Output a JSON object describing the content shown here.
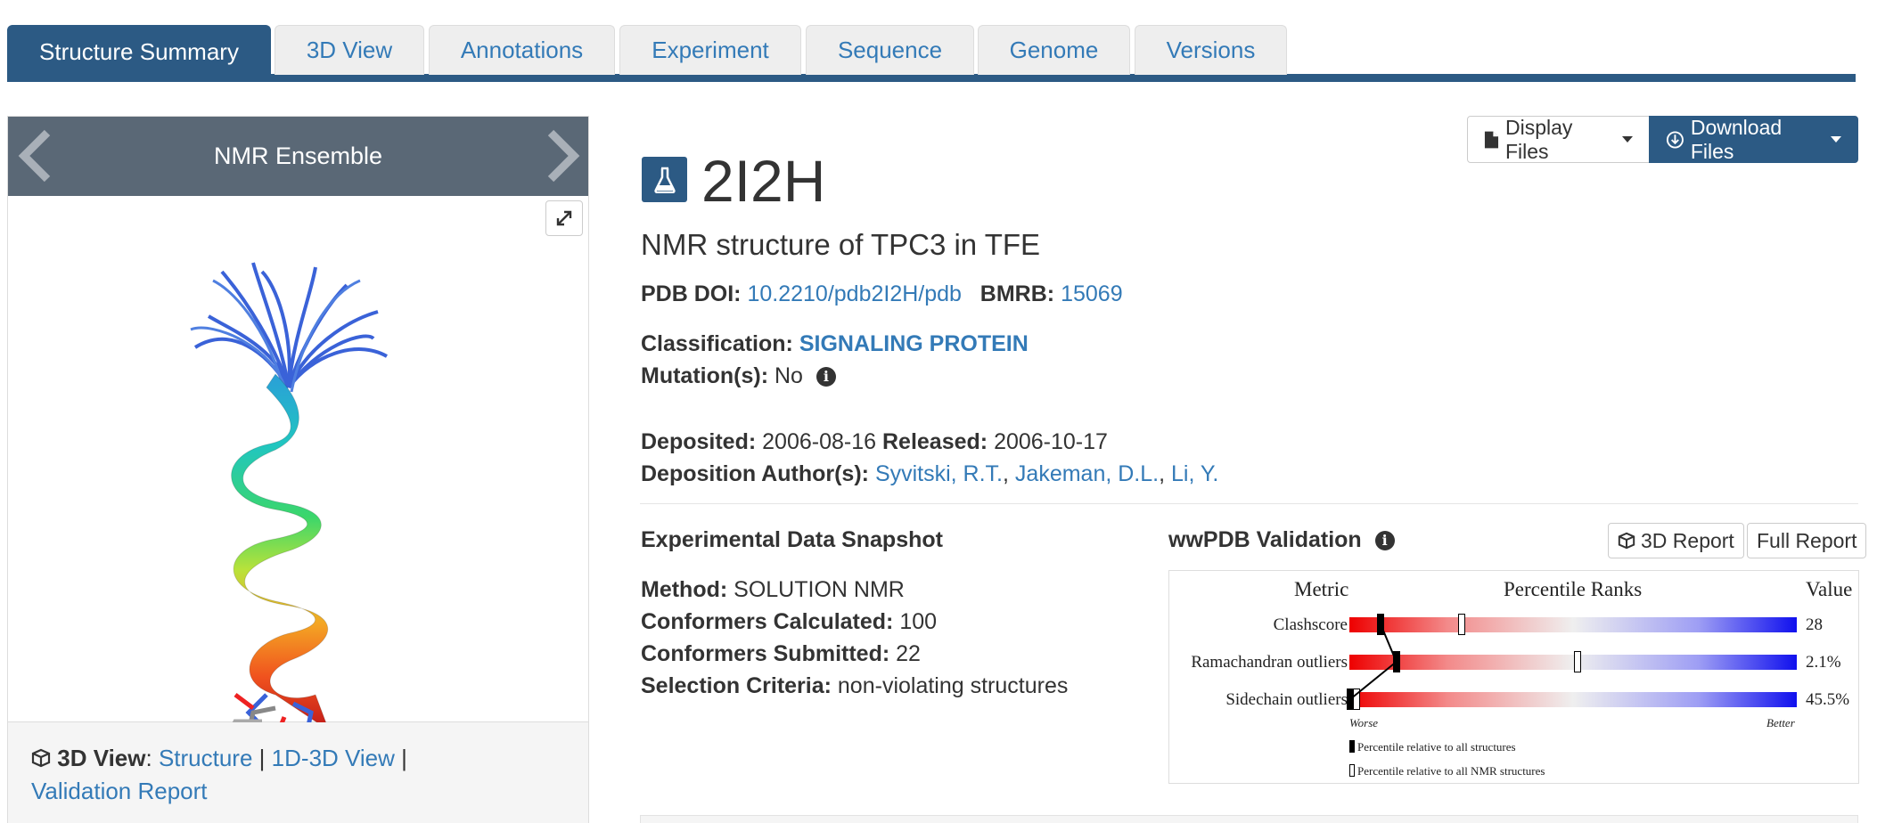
{
  "tabs": [
    "Structure Summary",
    "3D View",
    "Annotations",
    "Experiment",
    "Sequence",
    "Genome",
    "Versions"
  ],
  "active_tab": "Structure Summary",
  "viewer": {
    "title": "NMR Ensemble",
    "footer_label": "3D View",
    "links": [
      "Structure",
      "1D-3D View",
      "Validation Report"
    ],
    "separator": "|"
  },
  "buttons": {
    "display_files": "Display Files",
    "download_files": "Download Files"
  },
  "entry": {
    "id": "2I2H",
    "title": "NMR structure of TPC3 in TFE",
    "doi_label": "PDB DOI:",
    "doi": "10.2210/pdb2I2H/pdb",
    "bmrb_label": "BMRB:",
    "bmrb": "15069",
    "classification_label": "Classification:",
    "classification": "SIGNALING PROTEIN",
    "mutation_label": "Mutation(s):",
    "mutation": "No",
    "deposited_label": "Deposited:",
    "deposited": "2006-08-16",
    "released_label": "Released:",
    "released": "2006-10-17",
    "authors_label": "Deposition Author(s):",
    "authors": [
      "Syvitski, R.T.",
      "Jakeman, D.L.",
      "Li, Y."
    ]
  },
  "experimental": {
    "heading": "Experimental Data Snapshot",
    "method_label": "Method:",
    "method": "SOLUTION NMR",
    "calc_label": "Conformers Calculated:",
    "calc": "100",
    "sub_label": "Conformers Submitted:",
    "sub": "22",
    "crit_label": "Selection Criteria:",
    "crit": "non-violating structures"
  },
  "validation": {
    "heading": "wwPDB Validation",
    "report_3d": "3D Report",
    "report_full": "Full Report",
    "col_metric": "Metric",
    "col_ranks": "Percentile Ranks",
    "col_value": "Value",
    "metrics": [
      {
        "name": "Clashscore",
        "value": "28",
        "pct_all": 0.07,
        "pct_nmr": 0.25
      },
      {
        "name": "Ramachandran outliers",
        "value": "2.1%",
        "pct_all": 0.105,
        "pct_nmr": 0.51
      },
      {
        "name": "Sidechain outliers",
        "value": "45.5%",
        "pct_all": 0.002,
        "pct_nmr": 0.015
      }
    ],
    "worse": "Worse",
    "better": "Better",
    "legend_all": "Percentile relative to all structures",
    "legend_nmr": "Percentile relative to all NMR structures"
  },
  "colors": {
    "brand": "#2c5a84",
    "link": "#337ab7"
  }
}
